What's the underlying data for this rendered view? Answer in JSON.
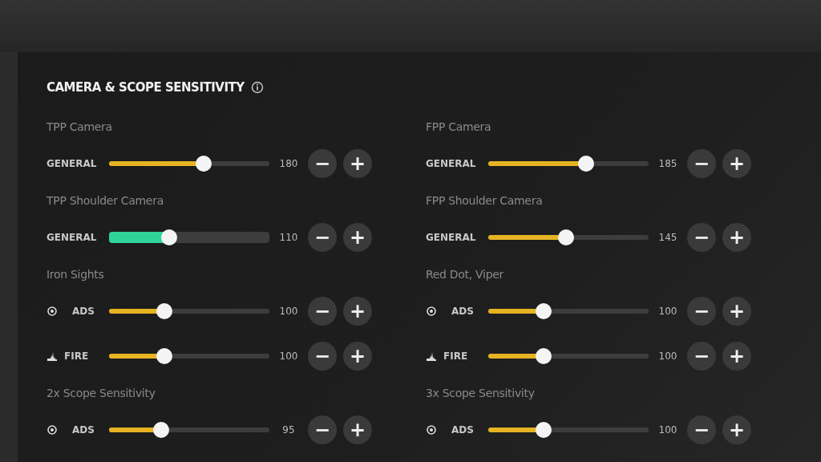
{
  "panel": {
    "title": "CAMERA & SCOPE SENSITIVITY",
    "columns": [
      [
        {
          "label": "TPP Camera",
          "sliders": [
            {
              "kind": "plain",
              "label": "GENERAL",
              "level": 0.59,
              "active": false,
              "reading": "180"
            }
          ]
        },
        {
          "label": "TPP Shoulder Camera",
          "sliders": [
            {
              "kind": "plain",
              "label": "GENERAL",
              "level": 0.375,
              "active": true,
              "reading": "110"
            }
          ]
        },
        {
          "label": "Iron Sights",
          "sliders": [
            {
              "kind": "ads",
              "label": "ADS",
              "level": 0.345,
              "active": false,
              "reading": "100"
            },
            {
              "kind": "fire",
              "label": "FIRE",
              "level": 0.345,
              "active": false,
              "reading": "100"
            }
          ]
        },
        {
          "label": "2x Scope Sensitivity",
          "sliders": [
            {
              "kind": "ads",
              "label": "ADS",
              "level": 0.325,
              "active": false,
              "reading": "95"
            }
          ]
        }
      ],
      [
        {
          "label": "FPP Camera",
          "sliders": [
            {
              "kind": "plain",
              "label": "GENERAL",
              "level": 0.61,
              "active": false,
              "reading": "185"
            }
          ]
        },
        {
          "label": "FPP Shoulder Camera",
          "sliders": [
            {
              "kind": "plain",
              "label": "GENERAL",
              "level": 0.485,
              "active": false,
              "reading": "145"
            }
          ]
        },
        {
          "label": "Red Dot, Viper",
          "sliders": [
            {
              "kind": "ads",
              "label": "ADS",
              "level": 0.345,
              "active": false,
              "reading": "100"
            },
            {
              "kind": "fire",
              "label": "FIRE",
              "level": 0.345,
              "active": false,
              "reading": "100"
            }
          ]
        },
        {
          "label": "3x Scope Sensitivity",
          "sliders": [
            {
              "kind": "ads",
              "label": "ADS",
              "level": 0.345,
              "active": false,
              "reading": "100"
            }
          ]
        }
      ]
    ],
    "buttons": {
      "minus": "−",
      "plus": "+"
    }
  }
}
